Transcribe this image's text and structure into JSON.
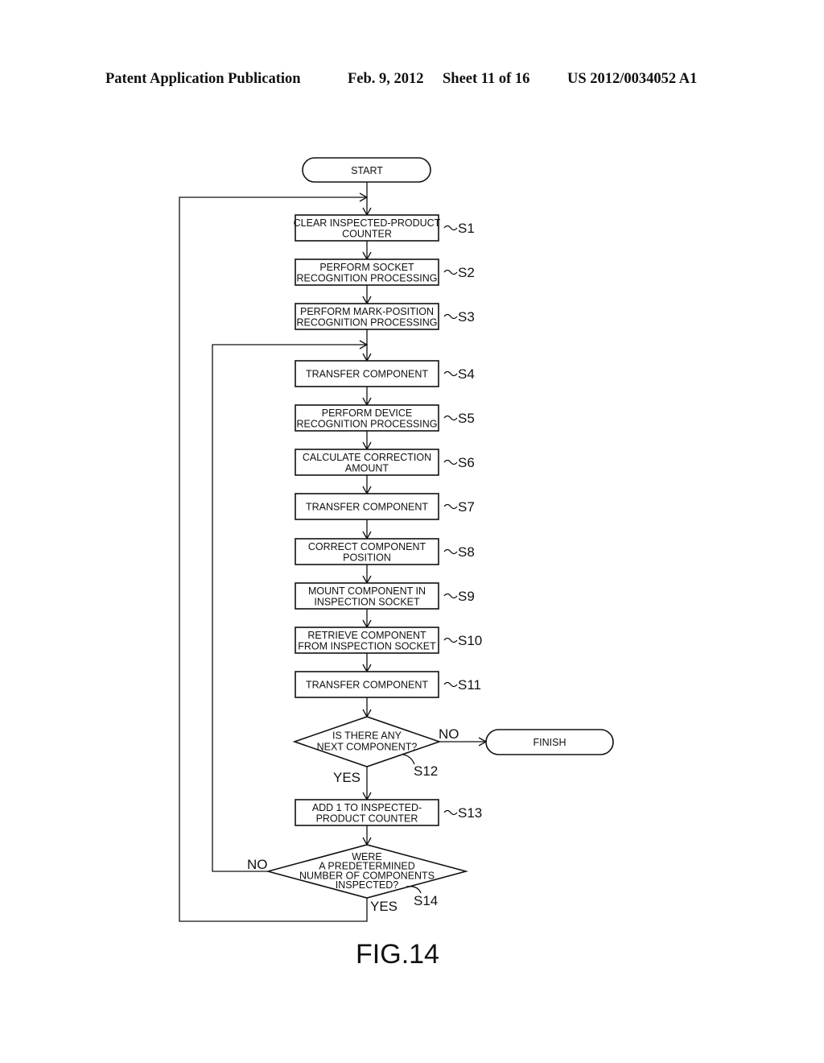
{
  "header": {
    "publication": "Patent Application Publication",
    "date": "Feb. 9, 2012",
    "sheet": "Sheet 11 of 16",
    "number": "US 2012/0034052 A1"
  },
  "flowchart": {
    "start": "START",
    "finish": "FINISH",
    "steps": [
      {
        "id": "S1",
        "lines": [
          "CLEAR INSPECTED-PRODUCT",
          "COUNTER"
        ]
      },
      {
        "id": "S2",
        "lines": [
          "PERFORM SOCKET",
          "RECOGNITION PROCESSING"
        ]
      },
      {
        "id": "S3",
        "lines": [
          "PERFORM MARK-POSITION",
          "RECOGNITION PROCESSING"
        ]
      },
      {
        "id": "S4",
        "lines": [
          "TRANSFER COMPONENT"
        ]
      },
      {
        "id": "S5",
        "lines": [
          "PERFORM DEVICE",
          "RECOGNITION PROCESSING"
        ]
      },
      {
        "id": "S6",
        "lines": [
          "CALCULATE CORRECTION",
          "AMOUNT"
        ]
      },
      {
        "id": "S7",
        "lines": [
          "TRANSFER COMPONENT"
        ]
      },
      {
        "id": "S8",
        "lines": [
          "CORRECT COMPONENT",
          "POSITION"
        ]
      },
      {
        "id": "S9",
        "lines": [
          "MOUNT COMPONENT IN",
          "INSPECTION SOCKET"
        ]
      },
      {
        "id": "S10",
        "lines": [
          "RETRIEVE COMPONENT",
          "FROM INSPECTION SOCKET"
        ]
      },
      {
        "id": "S11",
        "lines": [
          "TRANSFER COMPONENT"
        ]
      },
      {
        "id": "S13",
        "lines": [
          "ADD 1 TO INSPECTED-",
          "PRODUCT COUNTER"
        ]
      }
    ],
    "decisions": [
      {
        "id": "S12",
        "lines": [
          "IS THERE ANY",
          "NEXT COMPONENT?"
        ],
        "yes": "YES",
        "no": "NO"
      },
      {
        "id": "S14",
        "lines": [
          "WERE",
          "A PREDETERMINED",
          "NUMBER OF COMPONENTS",
          "INSPECTED?"
        ],
        "yes": "YES",
        "no": "NO"
      }
    ],
    "figure_label": "FIG.14"
  }
}
